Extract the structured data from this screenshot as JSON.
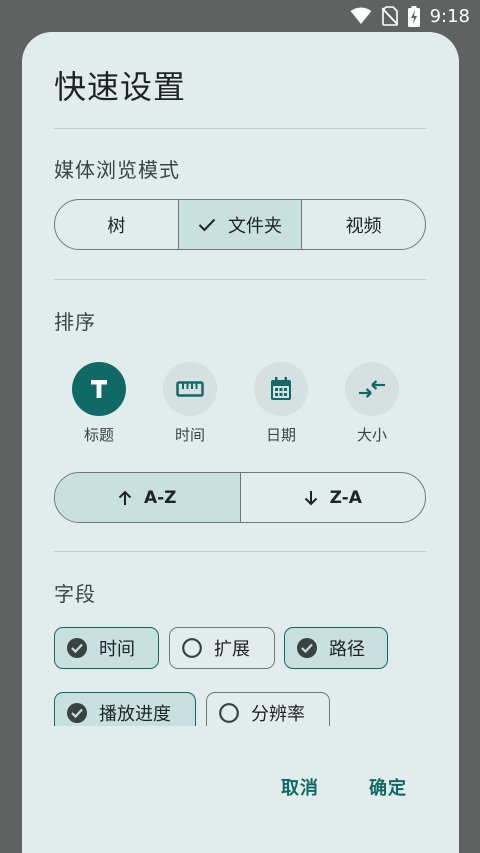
{
  "status": {
    "time": "9:18"
  },
  "dialog": {
    "title": "快速设置",
    "media_mode": {
      "label": "媒体浏览模式",
      "options": [
        "树",
        "文件夹",
        "视频"
      ],
      "selected": "文件夹"
    },
    "sort": {
      "label": "排序",
      "options": [
        {
          "label": "标题",
          "icon": "title-t-icon",
          "selected": true
        },
        {
          "label": "时间",
          "icon": "ruler-icon",
          "selected": false
        },
        {
          "label": "日期",
          "icon": "calendar-icon",
          "selected": false
        },
        {
          "label": "大小",
          "icon": "compress-arrows-icon",
          "selected": false
        }
      ],
      "order": {
        "asc": "A-Z",
        "desc": "Z-A",
        "selected": "A-Z"
      }
    },
    "fields": {
      "label": "字段",
      "chips": [
        {
          "label": "时间",
          "checked": true
        },
        {
          "label": "扩展",
          "checked": false
        },
        {
          "label": "路径",
          "checked": true
        },
        {
          "label": "播放进度",
          "checked": true
        },
        {
          "label": "分辨率",
          "checked": false
        }
      ]
    },
    "actions": {
      "cancel": "取消",
      "confirm": "确定"
    }
  },
  "colors": {
    "accent": "#0f6a66",
    "dialog_bg": "#e2ecec",
    "selected_bg": "#c8e0df",
    "scrim": "#5f6261"
  }
}
